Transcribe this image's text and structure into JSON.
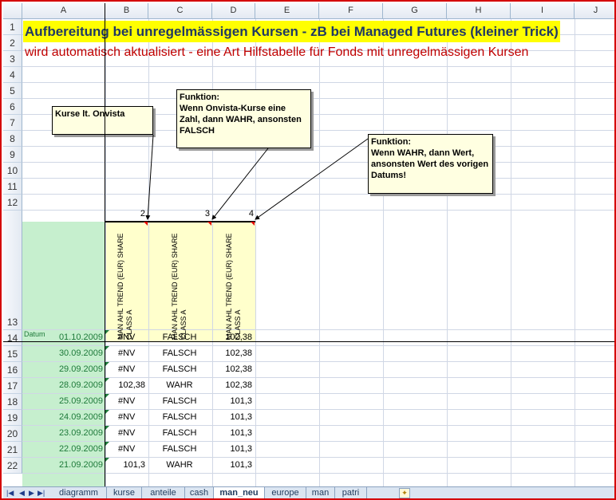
{
  "columns": [
    "A",
    "B",
    "C",
    "D",
    "E",
    "F",
    "G",
    "H",
    "I",
    "J"
  ],
  "rows": [
    "1",
    "2",
    "3",
    "4",
    "5",
    "6",
    "7",
    "8",
    "9",
    "10",
    "11",
    "12",
    "13",
    "14",
    "15",
    "16",
    "17",
    "18",
    "19",
    "20",
    "21",
    "22"
  ],
  "title": "Aufbereitung bei unregelmässigen Kursen - zB bei Managed Futures (kleiner Trick)",
  "subtitle": "wird automatisch aktualisiert - eine Art Hilfstabelle für Fonds mit unregelmässigen Kursen",
  "notes": {
    "kurse": "Kurse lt. Onvista",
    "funktion1": "Funktion:\nWenn Onvista-Kurse eine Zahl, dann WAHR, ansonsten FALSCH",
    "funktion2": "Funktion:\nWenn WAHR, dann Wert, ansonsten Wert des vorigen Datums!"
  },
  "row12": {
    "b": "2",
    "c": "3",
    "d": "4"
  },
  "row13": {
    "a": "Datum",
    "b": "MAN AHL TREND (EUR) SHARE CLASS A",
    "c": "MAN AHL TREND (EUR) SHARE CLASS A",
    "d": "MAN AHL TREND (EUR) SHARE CLASS A"
  },
  "data_rows": [
    {
      "date": "01.10.2009",
      "kurs": "#NV",
      "flag": "FALSCH",
      "wert": "102,38"
    },
    {
      "date": "30.09.2009",
      "kurs": "#NV",
      "flag": "FALSCH",
      "wert": "102,38"
    },
    {
      "date": "29.09.2009",
      "kurs": "#NV",
      "flag": "FALSCH",
      "wert": "102,38"
    },
    {
      "date": "28.09.2009",
      "kurs": "102,38",
      "flag": "WAHR",
      "wert": "102,38"
    },
    {
      "date": "25.09.2009",
      "kurs": "#NV",
      "flag": "FALSCH",
      "wert": "101,3"
    },
    {
      "date": "24.09.2009",
      "kurs": "#NV",
      "flag": "FALSCH",
      "wert": "101,3"
    },
    {
      "date": "23.09.2009",
      "kurs": "#NV",
      "flag": "FALSCH",
      "wert": "101,3"
    },
    {
      "date": "22.09.2009",
      "kurs": "#NV",
      "flag": "FALSCH",
      "wert": "101,3"
    },
    {
      "date": "21.09.2009",
      "kurs": "101,3",
      "flag": "WAHR",
      "wert": "101,3"
    }
  ],
  "tabs": [
    "diagramm",
    "kurse",
    "anteile",
    "cash",
    "man_neu",
    "europe",
    "man",
    "patri"
  ],
  "active_tab": "man_neu",
  "icons": {
    "nav": [
      "first-sheet-icon",
      "prev-sheet-icon",
      "next-sheet-icon",
      "last-sheet-icon"
    ],
    "new_sheet": "new-sheet-icon"
  },
  "colors": {
    "title_highlight": "#ffff00",
    "title_text": "#1f3864",
    "subtitle_text": "#c00000",
    "date_fill": "#c6efce",
    "header_fill": "#ffffcc",
    "date_text": "#1e7a3a",
    "frame": "#d40000"
  }
}
